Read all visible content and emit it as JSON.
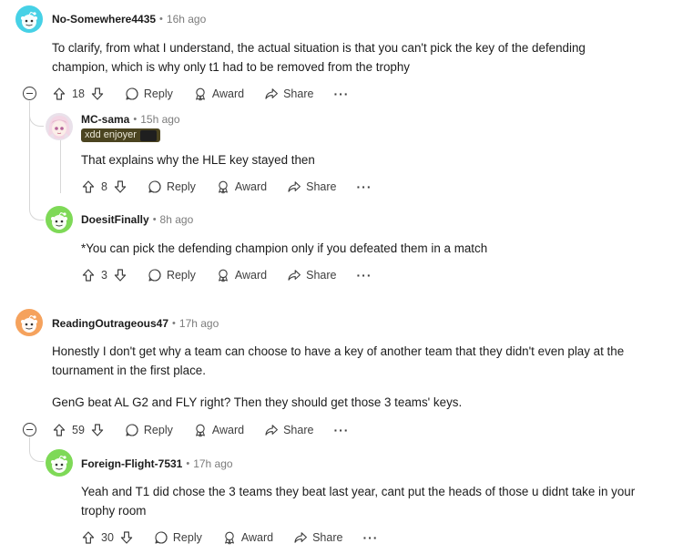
{
  "colors": {
    "avatar_teal": "#46d1e6",
    "avatar_green": "#7ed957",
    "avatar_orange": "#f5a25d",
    "flair_bg": "#4b4420"
  },
  "comments": [
    {
      "username": "No-Somewhere4435",
      "time": "16h ago",
      "avatar": "snoo-teal-avatar",
      "body": [
        "To clarify, from what I understand, the actual situation is that you can't pick the key of the defending",
        "champion, which is why only t1 had to be removed from the trophy"
      ],
      "votes": "18",
      "reply": "Reply",
      "award": "Award",
      "share": "Share",
      "more": "···"
    },
    {
      "username": "MC-sama",
      "time": "15h ago",
      "avatar": "anime-avatar",
      "flair": "xdd enjoyer",
      "body": [
        "That explains why the HLE key stayed then"
      ],
      "votes": "8",
      "reply": "Reply",
      "award": "Award",
      "share": "Share",
      "more": "···"
    },
    {
      "username": "DoesitFinally",
      "time": "8h ago",
      "avatar": "snoo-green-avatar",
      "body": [
        "*You can pick the defending champion only if you defeated them in a match"
      ],
      "votes": "3",
      "reply": "Reply",
      "award": "Award",
      "share": "Share",
      "more": "···"
    },
    {
      "username": "ReadingOutrageous47",
      "time": "17h ago",
      "avatar": "snoo-orange-avatar",
      "body": [
        "Honestly I don't get why a team can choose to have a key of another team that they didn't even play at the",
        "tournament in the first place."
      ],
      "body2": "GenG beat AL G2 and FLY right? Then they should get those 3 teams' keys.",
      "votes": "59",
      "reply": "Reply",
      "award": "Award",
      "share": "Share",
      "more": "···"
    },
    {
      "username": "Foreign-Flight-7531",
      "time": "17h ago",
      "avatar": "snoo-green-avatar",
      "body": [
        "Yeah and T1 did chose the 3 teams they beat last year, cant put the heads of those u didnt take in your",
        "trophy room"
      ],
      "votes": "30",
      "reply": "Reply",
      "award": "Award",
      "share": "Share",
      "more": "···"
    }
  ],
  "separator": "•"
}
